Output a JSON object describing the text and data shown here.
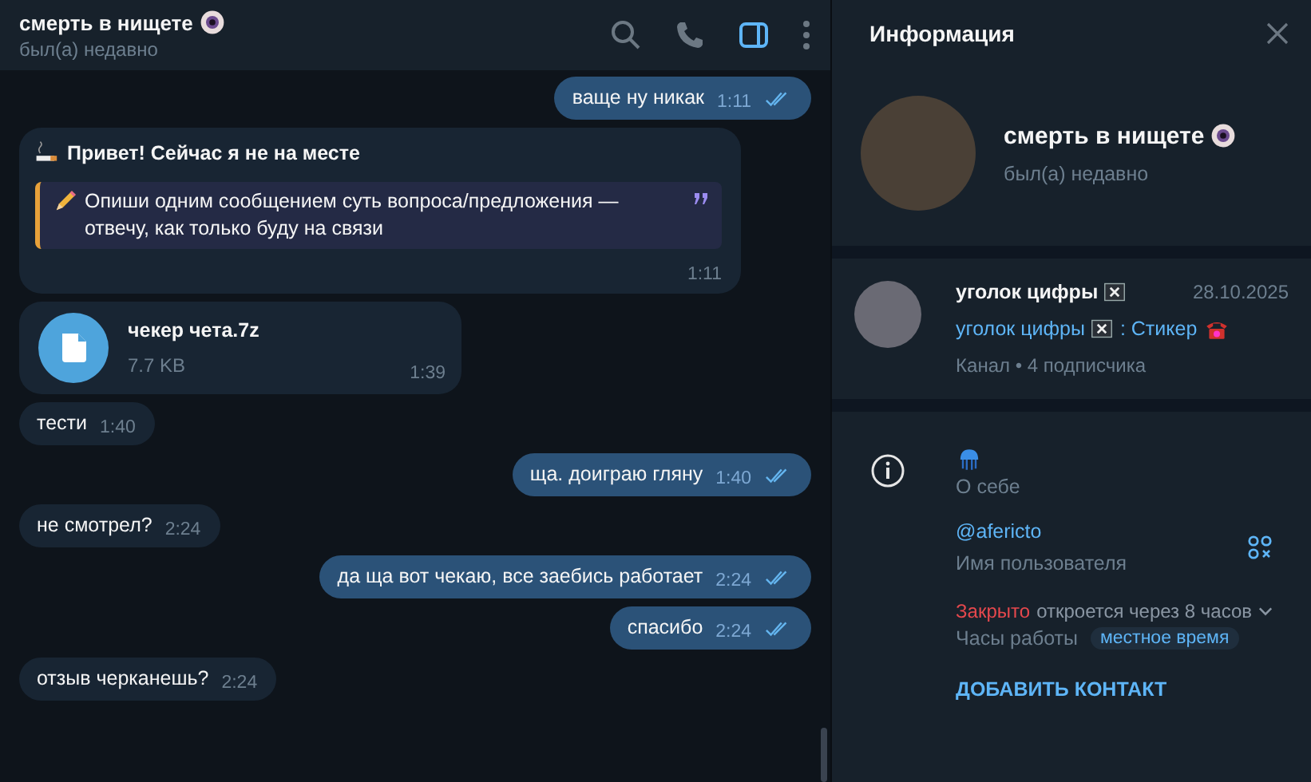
{
  "chat_header": {
    "title": "смерть в нищете",
    "status": "был(а) недавно",
    "side_panel_open": true
  },
  "messages": [
    {
      "kind": "text",
      "outgoing": true,
      "text": "ваще ну никак",
      "time": "1:11",
      "read": true
    },
    {
      "kind": "autoreply",
      "outgoing": false,
      "title": "Привет! Сейчас я не на месте",
      "quote": "Опиши одним сообщением суть вопроса/предложения — отвечу, как только буду на связи",
      "time": "1:11"
    },
    {
      "kind": "file",
      "outgoing": false,
      "name": "чекер чета.7z",
      "size": "7.7 KB",
      "time": "1:39"
    },
    {
      "kind": "text",
      "outgoing": false,
      "text": "тести",
      "time": "1:40"
    },
    {
      "kind": "text",
      "outgoing": true,
      "text": "ща. доиграю гляну",
      "time": "1:40",
      "read": true
    },
    {
      "kind": "text",
      "outgoing": false,
      "text": "не смотрел?",
      "time": "2:24"
    },
    {
      "kind": "text",
      "outgoing": true,
      "text": "да ща вот чекаю, все заебись работает",
      "time": "2:24",
      "read": true
    },
    {
      "kind": "text",
      "outgoing": true,
      "text": "спасибо",
      "time": "2:24",
      "read": true
    },
    {
      "kind": "text",
      "outgoing": false,
      "text": "отзыв черканешь?",
      "time": "2:24"
    }
  ],
  "info_panel": {
    "title": "Информация",
    "profile": {
      "name": "смерть в нищете",
      "status": "был(а) недавно"
    },
    "channel": {
      "name": "уголок цифры",
      "date": "28.10.2025",
      "preview_prefix": "уголок цифры",
      "preview_text": ": Стикер",
      "meta": "Канал • 4 подписчика"
    },
    "about": {
      "label": "О себе"
    },
    "username": {
      "value": "@afericto",
      "label": "Имя пользователя"
    },
    "hours": {
      "state": "Закрыто",
      "opens": "откроется через 8 часов",
      "label": "Часы работы",
      "badge": "местное время"
    },
    "add_contact": "ДОБАВИТЬ КОНТАКТ"
  }
}
